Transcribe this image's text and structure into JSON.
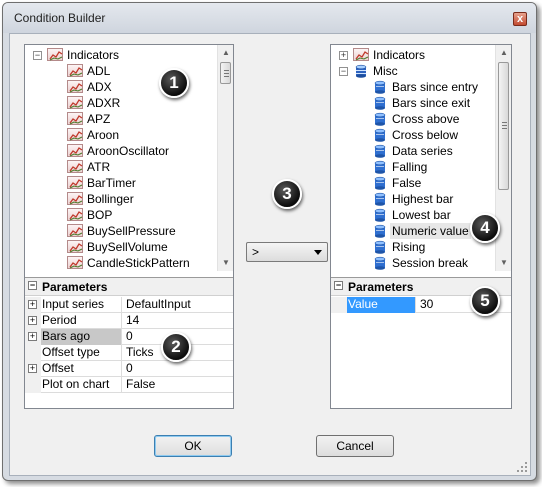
{
  "window": {
    "title": "Condition Builder",
    "close_glyph": "x"
  },
  "left_tree": {
    "root": {
      "label": "Indicators",
      "expander": "−",
      "icon": "indicator-chart-icon"
    },
    "items": [
      "ADL",
      "ADX",
      "ADXR",
      "APZ",
      "Aroon",
      "AroonOscillator",
      "ATR",
      "BarTimer",
      "Bollinger",
      "BOP",
      "BuySellPressure",
      "BuySellVolume",
      "CandleStickPattern"
    ]
  },
  "left_params": {
    "header": "Parameters",
    "header_expander": "−",
    "rows": [
      {
        "expander": "+",
        "name": "Input series",
        "value": "DefaultInput"
      },
      {
        "expander": "+",
        "name": "Period",
        "value": "14"
      },
      {
        "expander": "+",
        "name": "Bars ago",
        "value": "0",
        "highlight": true
      },
      {
        "expander": "",
        "name": "Offset type",
        "value": "Ticks"
      },
      {
        "expander": "+",
        "name": "Offset",
        "value": "0"
      },
      {
        "expander": "",
        "name": "Plot on chart",
        "value": "False"
      }
    ]
  },
  "operator": {
    "value": ">"
  },
  "right_tree": {
    "root_indicators": {
      "label": "Indicators",
      "expander": "+",
      "icon": "indicator-chart-icon"
    },
    "root_misc": {
      "label": "Misc",
      "expander": "−",
      "icon": "misc-database-icon"
    },
    "items": [
      "Bars since entry",
      "Bars since exit",
      "Cross above",
      "Cross below",
      "Data series",
      "Falling",
      "False",
      "Highest bar",
      "Lowest bar",
      "Numeric value",
      "Rising",
      "Session break"
    ],
    "selected": "Numeric value"
  },
  "right_params": {
    "header": "Parameters",
    "header_expander": "−",
    "rows": [
      {
        "name": "Value",
        "value": "30",
        "selected": true
      }
    ]
  },
  "buttons": {
    "ok": "OK",
    "cancel": "Cancel"
  },
  "callouts": [
    "1",
    "2",
    "3",
    "4",
    "5"
  ],
  "colors": {
    "selection": "#3399ff",
    "accent_border": "#3c7fb1",
    "close": "#c24a30"
  }
}
